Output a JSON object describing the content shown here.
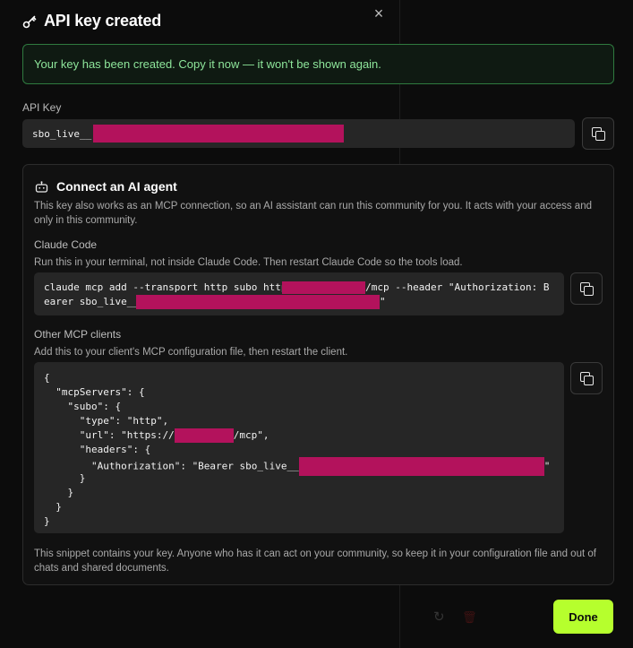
{
  "dialog": {
    "title": "API key created",
    "close_icon": "×",
    "alert_text": "Your key has been created. Copy it now — it won't be shown again.",
    "api_key_label": "API Key",
    "api_key_prefix": "sbo_live_",
    "done_label": "Done"
  },
  "agent": {
    "title": "Connect an AI agent",
    "description": "This key also works as an MCP connection, so an AI assistant can run this community for you. It acts with your access and only in this community.",
    "claude_code": {
      "label": "Claude Code",
      "description": "Run this in your terminal, not inside Claude Code. Then restart Claude Code so the tools load.",
      "line1_a": "claude mcp add --transport http subo https",
      "line1_b": "/mcp --header \"Authorization: B",
      "line2_a": "earer sbo_live__",
      "line2_b": "\""
    },
    "other_clients": {
      "label": "Other MCP clients",
      "description": "Add this to your client's MCP configuration file, then restart the client.",
      "lines": {
        "l1": "{",
        "l2": "  \"mcpServers\": {",
        "l3": "    \"subo\": {",
        "l4": "      \"type\": \"http\",",
        "l5_a": "      \"url\": \"https://",
        "l5_b": "/mcp\",",
        "l6": "      \"headers\": {",
        "l7_a": "        \"Authorization\": \"Bearer sbo_live__",
        "l7_b": "\"",
        "l8": "      }",
        "l9": "    }",
        "l10": "  }",
        "l11": "}"
      }
    },
    "footnote": "This snippet contains your key. Anyone who has it can act on your community, so keep it in your configuration file and out of chats and shared documents."
  },
  "icons": {
    "title_icon": "key-icon",
    "agent_icon": "bot-icon",
    "copy_icon": "copy-icon",
    "reset_icon": "reset-icon",
    "trash_icon": "trash-icon"
  },
  "colors": {
    "accent": "#b6ff2d",
    "success_border": "#2f7a3f",
    "success_text": "#8ee69b",
    "redaction": "#b3125c"
  }
}
